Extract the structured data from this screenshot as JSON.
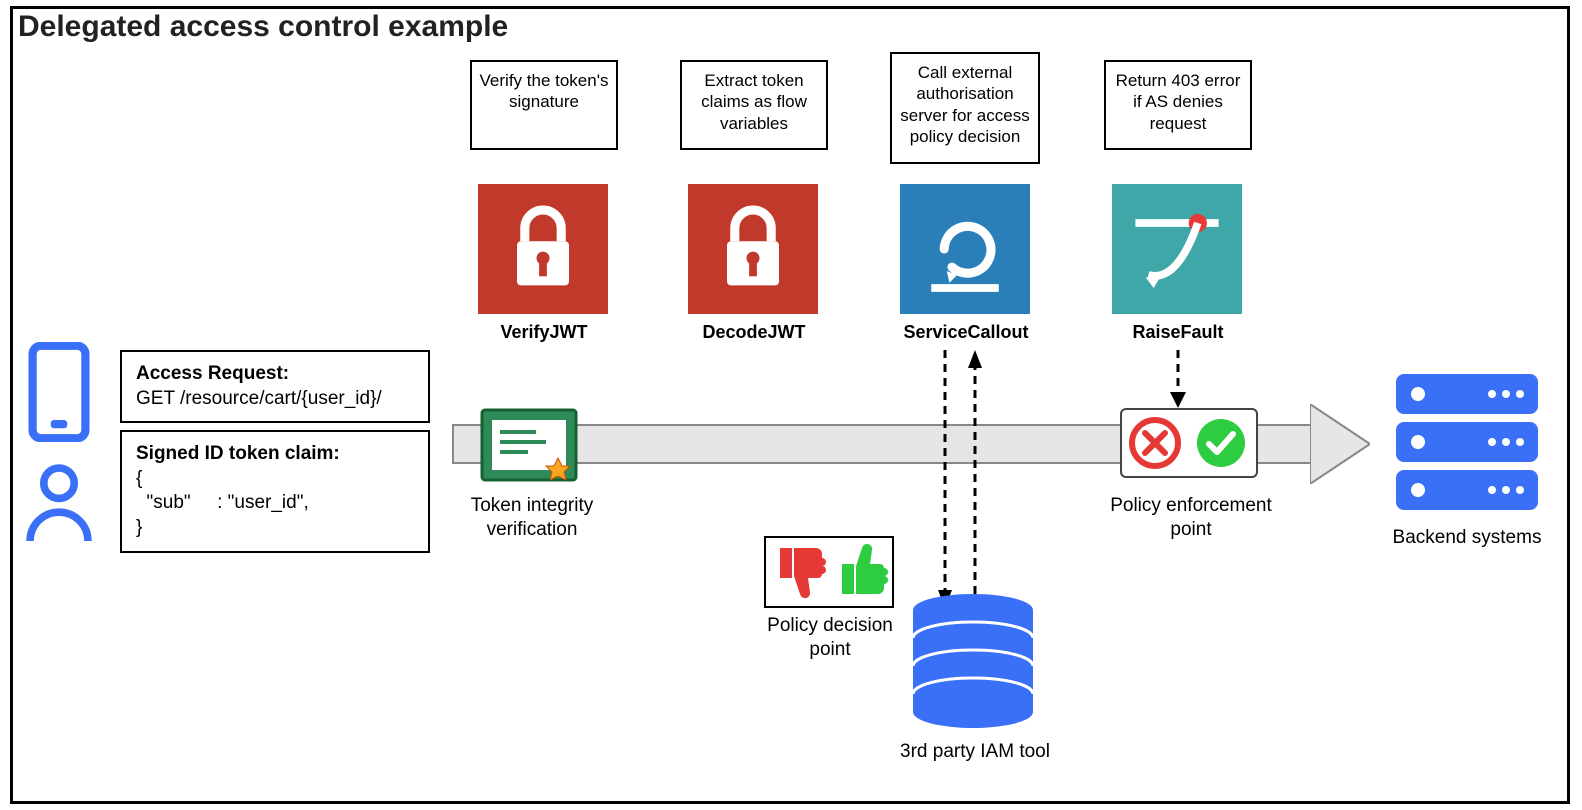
{
  "title": "Delegated access control example",
  "captions": {
    "verify": "Verify the token's signature",
    "extract": "Extract token claims as flow variables",
    "callout": "Call external authorisation server for access policy decision",
    "fault": "Return 403 error if AS denies request"
  },
  "policies": {
    "verify": "VerifyJWT",
    "decode": "DecodeJWT",
    "callout": "ServiceCallout",
    "fault": "RaiseFault"
  },
  "request": {
    "heading": "Access Request:",
    "line": "GET /resource/cart/{user_id}/"
  },
  "token": {
    "heading": "Signed ID token claim:",
    "body_open": "{",
    "body_line": "  \"sub\"     : \"user_id\",",
    "body_close": "}"
  },
  "labels": {
    "integrity": "Token integrity verification",
    "pdp": "Policy decision point",
    "pep": "Policy enforcement point",
    "iam": "3rd party IAM tool",
    "backend": "Backend systems"
  },
  "colors": {
    "red_tile": "#c1392b",
    "blue_tile": "#2b7fb8",
    "teal_tile": "#3fa7a7",
    "blue_accent": "#3a6ff7",
    "green": "#2ecc40",
    "red": "#e53935"
  }
}
